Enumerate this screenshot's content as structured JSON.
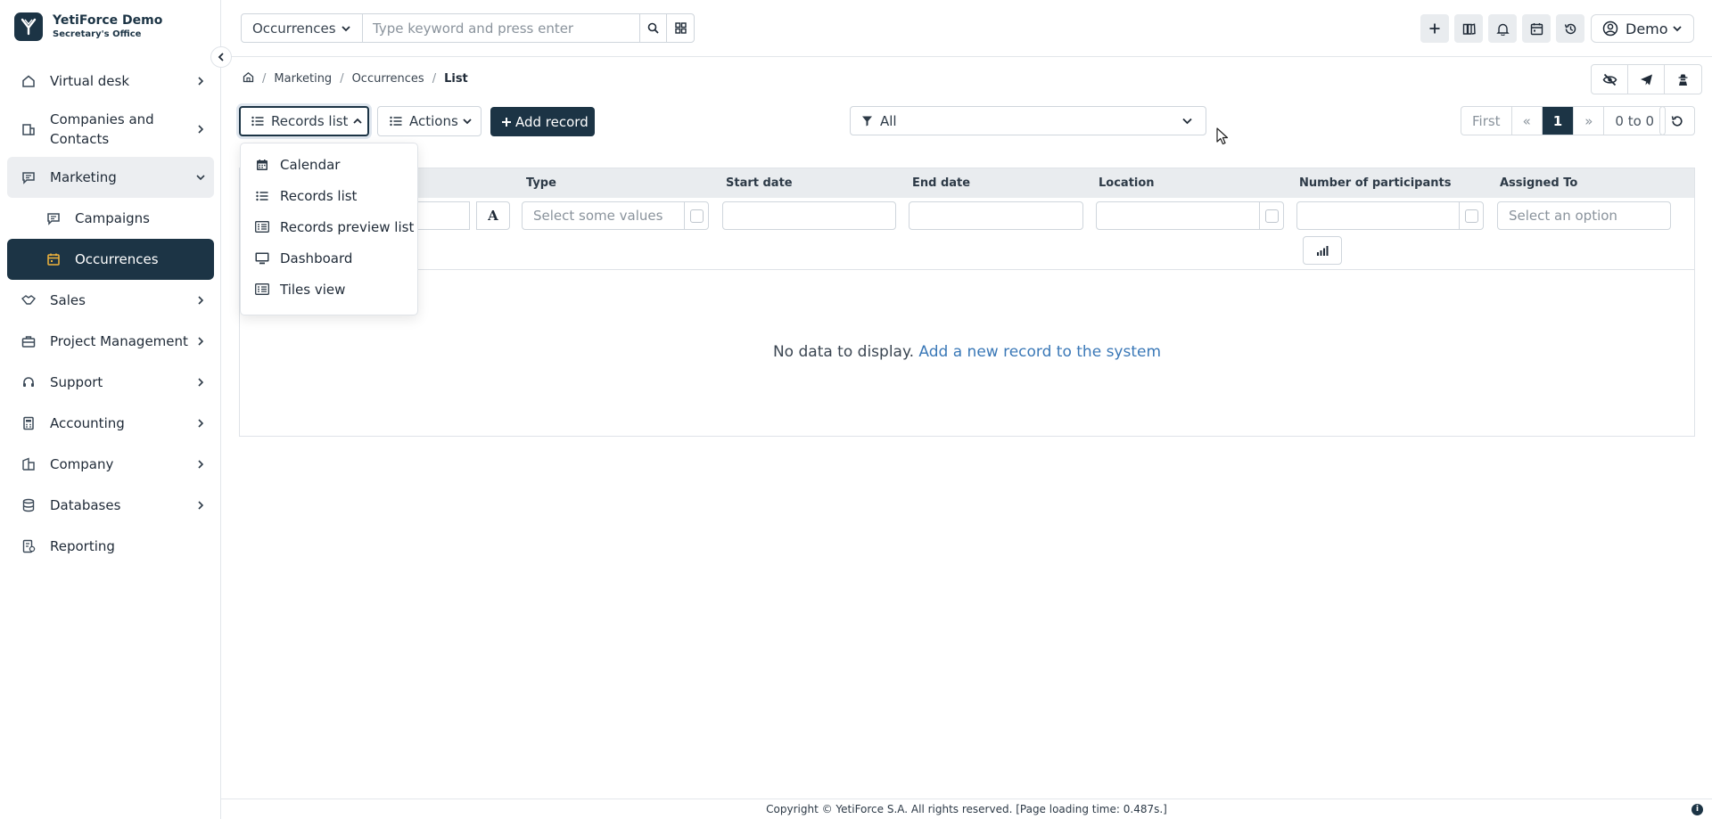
{
  "brand": {
    "name": "YetiForce Demo",
    "subtitle": "Secretary's Office"
  },
  "sidebar": {
    "items": [
      {
        "label": "Virtual desk",
        "icon": "home-icon"
      },
      {
        "label": "Companies and Contacts",
        "icon": "building-icon"
      },
      {
        "label": "Marketing",
        "icon": "message-icon",
        "expanded": true
      },
      {
        "label": "Campaigns",
        "icon": "message-icon",
        "sub": true
      },
      {
        "label": "Occurrences",
        "icon": "calendar-icon",
        "sub": true,
        "active": true
      },
      {
        "label": "Sales",
        "icon": "handshake-icon"
      },
      {
        "label": "Project Management",
        "icon": "briefcase-icon"
      },
      {
        "label": "Support",
        "icon": "headset-icon"
      },
      {
        "label": "Accounting",
        "icon": "calculator-icon"
      },
      {
        "label": "Company",
        "icon": "office-icon"
      },
      {
        "label": "Databases",
        "icon": "database-icon"
      },
      {
        "label": "Reporting",
        "icon": "report-icon"
      }
    ]
  },
  "topbar": {
    "module_select": "Occurrences",
    "search_placeholder": "Type keyword and press enter",
    "user": "Demo"
  },
  "breadcrumb": [
    "Marketing",
    "Occurrences",
    "List"
  ],
  "toolbar": {
    "records_label": "Records list",
    "actions_label": "Actions",
    "add_label": "Add record",
    "filter_value": "All"
  },
  "pagination": {
    "first": "First",
    "prev": "«",
    "current": "1",
    "next": "»",
    "range": "0 to 0"
  },
  "table": {
    "columns": [
      "Type",
      "Start date",
      "End date",
      "Location",
      "Number of participants",
      "Assigned To"
    ],
    "type_placeholder": "Select some values",
    "assigned_placeholder": "Select an option",
    "empty_text": "No data to display.",
    "empty_link": "Add a new record to the system"
  },
  "dropdown": {
    "items": [
      {
        "label": "Calendar",
        "icon": "calendar-icon"
      },
      {
        "label": "Records list",
        "icon": "list-icon"
      },
      {
        "label": "Records preview list",
        "icon": "preview-list-icon"
      },
      {
        "label": "Dashboard",
        "icon": "monitor-icon"
      },
      {
        "label": "Tiles view",
        "icon": "tiles-icon"
      }
    ]
  },
  "footer": {
    "text": "Copyright © YetiForce S.A. All rights reserved. [Page loading time: 0.487s.]"
  },
  "colors": {
    "primary": "#1c3445",
    "accent": "#f0b33c",
    "link": "#3a78b7"
  }
}
